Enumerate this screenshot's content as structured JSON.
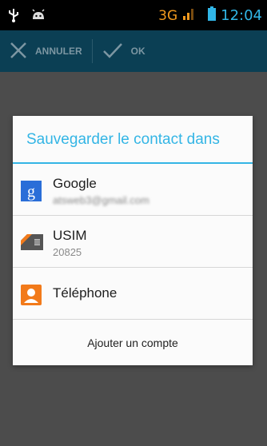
{
  "status_bar": {
    "network": "3G",
    "time": "12:04"
  },
  "action_bar": {
    "cancel_label": "ANNULER",
    "ok_label": "OK"
  },
  "dialog": {
    "title": "Sauvegarder le contact dans",
    "accounts": [
      {
        "label": "Google",
        "sublabel": "atsweb3@gmail.com",
        "icon": "google-icon"
      },
      {
        "label": "USIM",
        "sublabel": "20825",
        "icon": "sim-card-icon"
      },
      {
        "label": "Téléphone",
        "sublabel": "",
        "icon": "phone-contact-icon"
      }
    ],
    "add_account_label": "Ajouter un compte"
  },
  "colors": {
    "accent": "#33b5e5",
    "action_bar": "#0b3f54",
    "network": "#f39a1e"
  }
}
